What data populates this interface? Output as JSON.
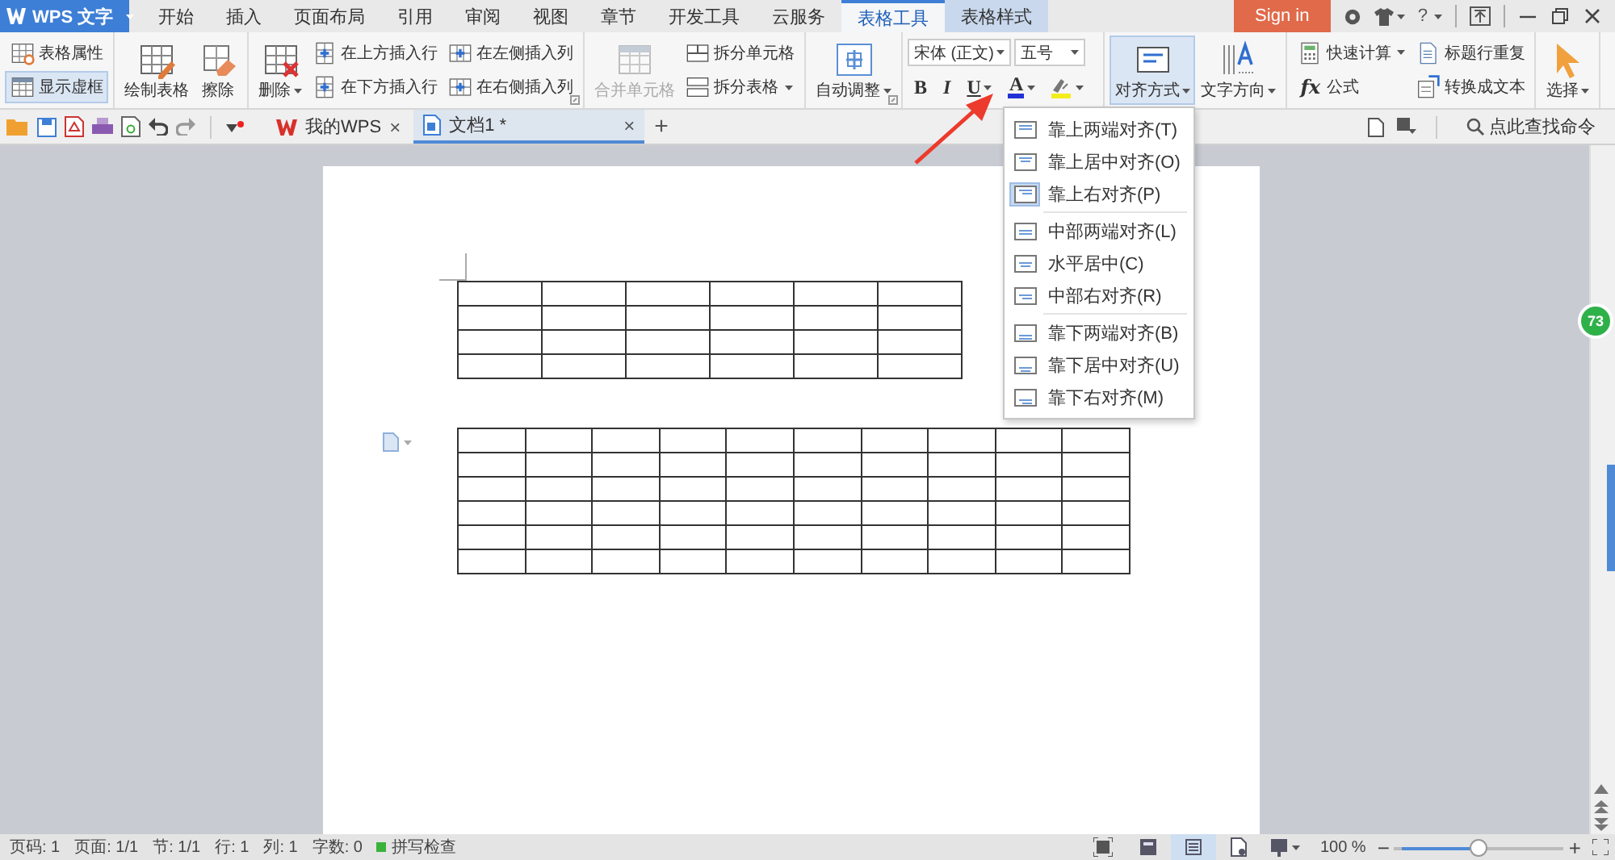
{
  "title_bar": {
    "app_menu": "WPS 文字",
    "tabs": [
      {
        "label": "开始",
        "selected": false,
        "contextual": false
      },
      {
        "label": "插入",
        "selected": false,
        "contextual": false
      },
      {
        "label": "页面布局",
        "selected": false,
        "contextual": false
      },
      {
        "label": "引用",
        "selected": false,
        "contextual": false
      },
      {
        "label": "审阅",
        "selected": false,
        "contextual": false
      },
      {
        "label": "视图",
        "selected": false,
        "contextual": false
      },
      {
        "label": "章节",
        "selected": false,
        "contextual": false
      },
      {
        "label": "开发工具",
        "selected": false,
        "contextual": false
      },
      {
        "label": "云服务",
        "selected": false,
        "contextual": false
      },
      {
        "label": "表格工具",
        "selected": true,
        "contextual": true
      },
      {
        "label": "表格样式",
        "selected": false,
        "contextual": true
      }
    ],
    "sign_in": "Sign in",
    "help": "?"
  },
  "ribbon": {
    "groups": [
      {
        "launcher": false,
        "items": [
          {
            "kind": "stack",
            "buttons": [
              {
                "label": "表格属性",
                "selected": false,
                "disabled": false,
                "dropdown": false
              },
              {
                "label": "显示虚框",
                "selected": true,
                "disabled": false,
                "dropdown": false
              }
            ]
          }
        ]
      },
      {
        "launcher": false,
        "items": [
          {
            "kind": "large",
            "label": "绘制表格",
            "selected": false,
            "disabled": false,
            "dropdown": false
          },
          {
            "kind": "large",
            "label": "擦除",
            "selected": false,
            "disabled": false,
            "dropdown": false
          }
        ]
      },
      {
        "launcher": true,
        "items": [
          {
            "kind": "large",
            "label": "删除",
            "selected": false,
            "disabled": false,
            "dropdown": true
          },
          {
            "kind": "stack",
            "buttons": [
              {
                "label": "在上方插入行",
                "selected": false,
                "disabled": false,
                "dropdown": false
              },
              {
                "label": "在下方插入行",
                "selected": false,
                "disabled": false,
                "dropdown": false
              }
            ]
          },
          {
            "kind": "stack",
            "buttons": [
              {
                "label": "在左侧插入列",
                "selected": false,
                "disabled": false,
                "dropdown": false
              },
              {
                "label": "在右侧插入列",
                "selected": false,
                "disabled": false,
                "dropdown": false
              }
            ]
          }
        ]
      },
      {
        "launcher": false,
        "items": [
          {
            "kind": "large",
            "label": "合并单元格",
            "selected": false,
            "disabled": true,
            "dropdown": false
          },
          {
            "kind": "stack",
            "buttons": [
              {
                "label": "拆分单元格",
                "selected": false,
                "disabled": false,
                "dropdown": false
              },
              {
                "label": "拆分表格",
                "selected": false,
                "disabled": false,
                "dropdown": true
              }
            ]
          }
        ]
      },
      {
        "launcher": true,
        "items": [
          {
            "kind": "large",
            "label": "自动调整",
            "selected": false,
            "disabled": false,
            "dropdown": true
          }
        ]
      },
      {
        "launcher": false,
        "items": [
          {
            "kind": "font",
            "font": "宋体 (正文)",
            "size": "五号",
            "format": [
              {
                "kind": "text",
                "label": "B",
                "dropdown": false
              },
              {
                "kind": "text",
                "label": "I",
                "dropdown": false
              },
              {
                "kind": "text",
                "label": "U",
                "dropdown": true
              },
              {
                "kind": "color-text",
                "label": "A",
                "dropdown": true
              },
              {
                "kind": "highlight",
                "dropdown": true
              }
            ]
          }
        ]
      },
      {
        "launcher": false,
        "items": [
          {
            "kind": "large",
            "label": "对齐方式",
            "selected": true,
            "disabled": false,
            "dropdown": true
          },
          {
            "kind": "large",
            "label": "文字方向",
            "selected": false,
            "disabled": false,
            "dropdown": true
          }
        ]
      },
      {
        "launcher": false,
        "items": [
          {
            "kind": "stack",
            "buttons": [
              {
                "label": "快速计算",
                "selected": false,
                "disabled": false,
                "dropdown": true
              },
              {
                "label": "公式",
                "icon_text": "fx",
                "selected": false,
                "disabled": false,
                "dropdown": false
              }
            ]
          },
          {
            "kind": "stack",
            "buttons": [
              {
                "label": "标题行重复",
                "selected": false,
                "disabled": false,
                "dropdown": false
              },
              {
                "label": "转换成文本",
                "selected": false,
                "disabled": false,
                "dropdown": false
              }
            ]
          }
        ]
      },
      {
        "launcher": false,
        "items": [
          {
            "kind": "large",
            "label": "选择",
            "selected": false,
            "disabled": false,
            "dropdown": true
          }
        ]
      }
    ]
  },
  "doc_tabs": {
    "tabs": [
      {
        "kind": "home",
        "label": "我的WPS",
        "close": "×",
        "selected": false
      },
      {
        "kind": "document",
        "label": "文档1 *",
        "close": "×",
        "selected": true
      }
    ],
    "new_tab": "+",
    "search": "点此查找命令"
  },
  "document": {
    "tables": [
      {
        "rows": [
          {
            "cells": [
              {},
              {},
              {},
              {},
              {},
              {}
            ]
          },
          {
            "cells": [
              {},
              {},
              {},
              {},
              {},
              {}
            ]
          },
          {
            "cells": [
              {},
              {},
              {},
              {},
              {},
              {}
            ]
          },
          {
            "cells": [
              {},
              {},
              {},
              {},
              {},
              {}
            ]
          }
        ]
      },
      {
        "rows": [
          {
            "cells": [
              {},
              {},
              {},
              {},
              {},
              {},
              {},
              {},
              {},
              {}
            ]
          },
          {
            "cells": [
              {},
              {},
              {},
              {},
              {},
              {},
              {},
              {},
              {},
              {}
            ]
          },
          {
            "cells": [
              {},
              {},
              {},
              {},
              {},
              {},
              {},
              {},
              {},
              {}
            ]
          },
          {
            "cells": [
              {},
              {},
              {},
              {},
              {},
              {},
              {},
              {},
              {},
              {}
            ]
          },
          {
            "cells": [
              {},
              {},
              {},
              {},
              {},
              {},
              {},
              {},
              {},
              {}
            ]
          },
          {
            "cells": [
              {},
              {},
              {},
              {},
              {},
              {},
              {},
              {},
              {},
              {}
            ]
          }
        ]
      }
    ]
  },
  "floating_badge": "73",
  "menu": {
    "sections": [
      {
        "items": [
          {
            "label": "靠上两端对齐(T)",
            "selected": false
          },
          {
            "label": "靠上居中对齐(O)",
            "selected": false
          },
          {
            "label": "靠上右对齐(P)",
            "selected": true
          }
        ]
      },
      {
        "items": [
          {
            "label": "中部两端对齐(L)",
            "selected": false
          },
          {
            "label": "水平居中(C)",
            "selected": false
          },
          {
            "label": "中部右对齐(R)",
            "selected": false
          }
        ]
      },
      {
        "items": [
          {
            "label": "靠下两端对齐(B)",
            "selected": false
          },
          {
            "label": "靠下居中对齐(U)",
            "selected": false
          },
          {
            "label": "靠下右对齐(M)",
            "selected": false
          }
        ]
      }
    ]
  },
  "annotation_arrow": true,
  "status_bar": {
    "items": [
      "页码: 1",
      "页面: 1/1",
      "节: 1/1",
      "行: 1",
      "列: 1",
      "字数: 0"
    ],
    "spell_check": "拼写检查",
    "views": [
      {
        "selected": false
      },
      {
        "selected": true
      },
      {
        "selected": false
      },
      {
        "selected": false
      }
    ],
    "zoom": "100 %",
    "zoom_out": "−",
    "zoom_in": "+",
    "zoom_slider": {
      "level": 0.5
    }
  }
}
